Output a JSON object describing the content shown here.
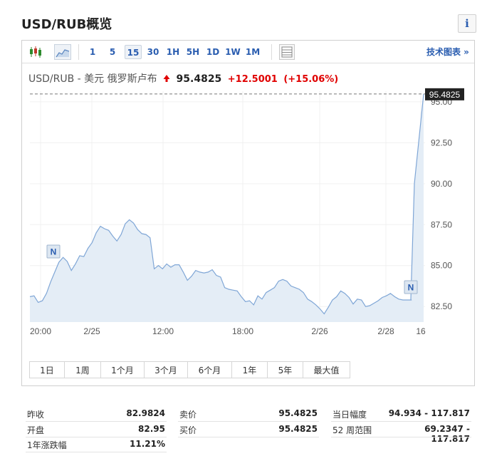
{
  "header": {
    "title": "USD/RUB概览",
    "info_label": "i"
  },
  "toolbar": {
    "intervals": [
      "1",
      "5",
      "15",
      "30",
      "1H",
      "5H",
      "1D",
      "1W",
      "1M"
    ],
    "active_interval": "15",
    "tech_chart_link": "技术图表 »",
    "icons": [
      "candlestick-icon",
      "area-chart-icon",
      "table-icon"
    ]
  },
  "quote": {
    "pair": "USD/RUB - 美元 俄罗斯卢布",
    "price": "95.4825",
    "change": "+12.5001",
    "change_pct": "(+15.06%)",
    "direction_icon": "up-arrow-icon",
    "up_color": "#e00000"
  },
  "chart_data": {
    "type": "area",
    "current_label": "95.4825",
    "y_ticks": [
      "95.00",
      "92.50",
      "90.00",
      "87.50",
      "85.00",
      "82.50"
    ],
    "ylim": [
      81.55,
      95.65
    ],
    "x_ticks": [
      "20:00",
      "2/25",
      "12:00",
      "18:00",
      "2/26",
      "2/28",
      "16"
    ],
    "markers": [
      "N",
      "N"
    ],
    "series_color": "#7fa6d6",
    "fill_color": "#e4edf6",
    "values": [
      83.1,
      83.15,
      82.75,
      82.85,
      83.3,
      84.0,
      84.6,
      85.2,
      85.5,
      85.25,
      84.7,
      85.1,
      85.6,
      85.55,
      86.05,
      86.4,
      87.0,
      87.4,
      87.25,
      87.15,
      86.8,
      86.5,
      86.9,
      87.55,
      87.8,
      87.6,
      87.2,
      86.95,
      86.9,
      86.7,
      84.8,
      85.0,
      84.8,
      85.1,
      84.9,
      85.05,
      85.05,
      84.6,
      84.1,
      84.35,
      84.7,
      84.6,
      84.55,
      84.6,
      84.75,
      84.4,
      84.3,
      83.65,
      83.55,
      83.5,
      83.45,
      83.1,
      82.8,
      82.85,
      82.6,
      83.15,
      82.95,
      83.35,
      83.5,
      83.65,
      84.05,
      84.15,
      84.05,
      83.75,
      83.65,
      83.55,
      83.35,
      82.95,
      82.8,
      82.6,
      82.35,
      82.05,
      82.45,
      82.9,
      83.1,
      83.45,
      83.3,
      83.05,
      82.65,
      82.95,
      82.9,
      82.5,
      82.55,
      82.7,
      82.85,
      83.05,
      83.15,
      83.3,
      83.1,
      82.95,
      82.9,
      82.9,
      82.9,
      82.95,
      90.0,
      95.48
    ]
  },
  "periods": [
    "1日",
    "1周",
    "1个月",
    "3个月",
    "6个月",
    "1年",
    "5年",
    "最大值"
  ],
  "stats": {
    "left": [
      {
        "label": "昨收",
        "value": "82.9824"
      },
      {
        "label": "开盘",
        "value": "82.95"
      },
      {
        "label": "1年涨跌幅",
        "value": "11.21%"
      }
    ],
    "mid": [
      {
        "label": "卖价",
        "value": "95.4825"
      },
      {
        "label": "买价",
        "value": "95.4825"
      }
    ],
    "right": [
      {
        "label": "当日幅度",
        "value": "94.934 - 117.817"
      },
      {
        "label": "52 周范围",
        "value": "69.2347 - 117.817"
      }
    ]
  }
}
